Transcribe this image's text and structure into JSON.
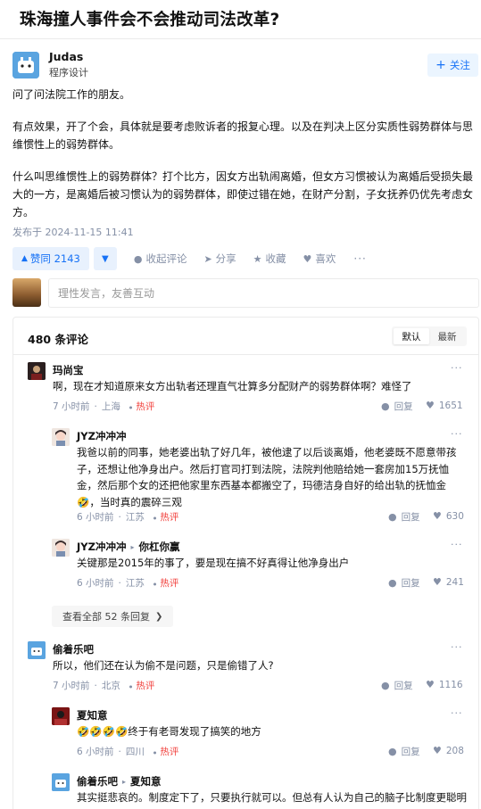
{
  "question": {
    "title": "珠海撞人事件会不会推动司法改革?"
  },
  "author": {
    "name": "Judas",
    "tagline": "程序设计",
    "follow_label": "关注",
    "follow_icon": "plus-icon"
  },
  "answer": {
    "paragraphs": [
      "问了问法院工作的朋友。",
      "有点效果，开了个会，具体就是要考虑败诉者的报复心理。以及在判决上区分实质性弱势群体与思维惯性上的弱势群体。",
      "什么叫思维惯性上的弱势群体？打个比方，因女方出轨闹离婚，但女方习惯被认为离婚后受损失最大的一方，是离婚后被习惯认为的弱势群体，即使过错在她，在财产分割，子女抚养仍优先考虑女方。"
    ],
    "published": "发布于 2024-11-15 11:41"
  },
  "actions": {
    "vote_up": "赞同 2143",
    "collapse_comments": "收起评论",
    "share": "分享",
    "favorite": "收藏",
    "like": "喜欢",
    "more": "···"
  },
  "comment_input": {
    "placeholder": "理性发言，友善互动"
  },
  "comments": {
    "count_label": "480 条评论",
    "sort_options": [
      "默认",
      "最新"
    ],
    "sort_selected": "默认",
    "reply_label": "回复",
    "hot_label": "热评",
    "view_all_replies": "查看全部 52 条回复",
    "thread": [
      {
        "name": "玛尚宝",
        "text": "啊，现在才知道原来女方出轨者还理直气壮算多分配财产的弱势群体啊？难怪了",
        "time": "7 小时前",
        "location": "上海",
        "hot": true,
        "likes": "1651",
        "replies": [
          {
            "name": "JYZ冲冲冲",
            "reply_to": "",
            "text": "我爸以前的同事，她老婆出轨了好几年，被他逮了以后谈离婚，他老婆既不愿意带孩子，还想让他净身出户。然后打官司打到法院，法院判他赔给她一套房加15万抚恤金，然后那个女的还把他家里东西基本都搬空了，玛德洁身自好的给出轨的抚恤金🤣，当时真的震碎三观",
            "time": "6 小时前",
            "location": "江苏",
            "hot": true,
            "likes": "630"
          },
          {
            "name": "JYZ冲冲冲",
            "reply_to": "你杠你赢",
            "text": "关键那是2015年的事了，要是现在搞不好真得让他净身出户",
            "time": "6 小时前",
            "location": "江苏",
            "hot": true,
            "likes": "241"
          }
        ]
      },
      {
        "name": "偷着乐吧",
        "text": "所以，他们还在认为偷不是问题，只是偷错了人?",
        "time": "7 小时前",
        "location": "北京",
        "hot": true,
        "likes": "1116",
        "replies": [
          {
            "name": "夏知意",
            "reply_to": "",
            "text": "🤣🤣🤣🤣终于有老哥发现了搞笑的地方",
            "time": "6 小时前",
            "location": "四川",
            "hot": true,
            "likes": "208"
          },
          {
            "name": "偷着乐吧",
            "reply_to": "夏知意",
            "text": "其实挺悲哀的。制度定下了，只要执行就可以。但总有人认为自己的脑子比制度更聪明",
            "time": "",
            "location": "",
            "hot": false,
            "likes": ""
          }
        ]
      }
    ]
  },
  "colors": {
    "brand_blue": "#1772f6",
    "hot_red": "#f1403c",
    "meta_gray": "#8590a6"
  }
}
